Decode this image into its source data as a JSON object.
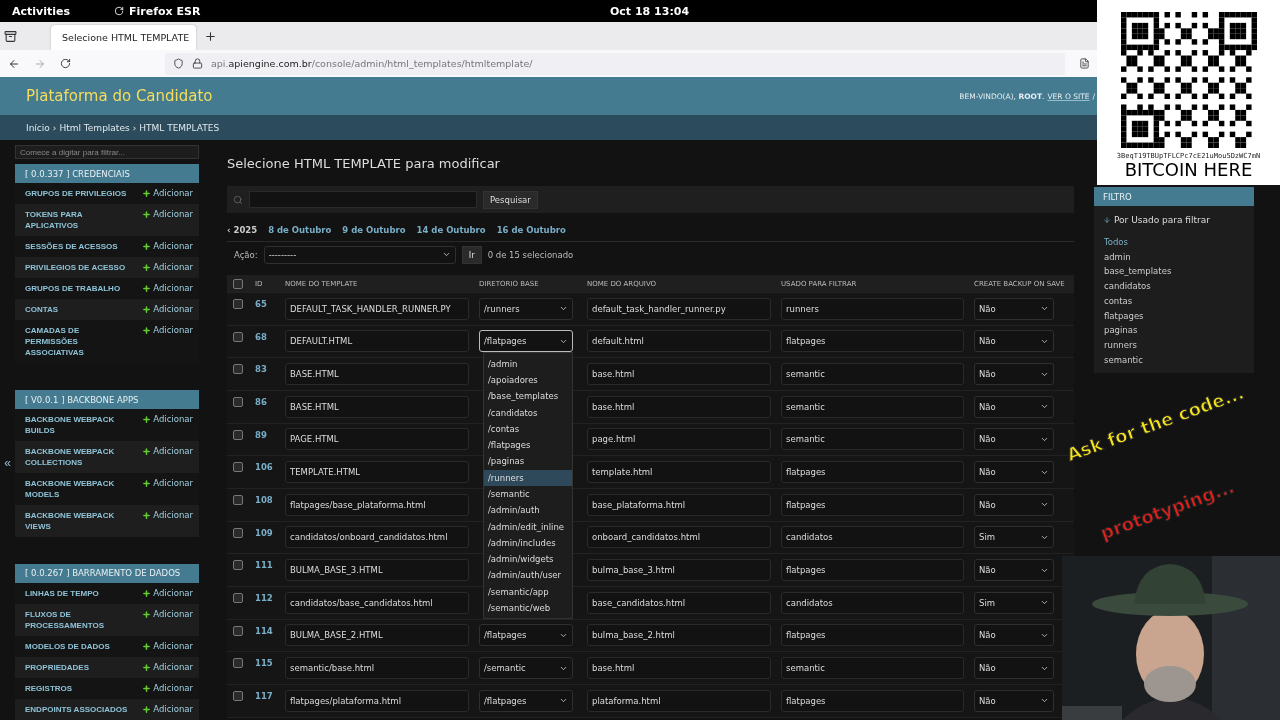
{
  "system_bar": {
    "activities": "Activities",
    "app": "Firefox ESR",
    "clock": "Oct 18  13:04"
  },
  "browser": {
    "tab": {
      "title": "Selecione HTML TEMPLATE",
      "selected": true
    },
    "url": {
      "host_prefix": "api.",
      "host": "apiengine.com.br",
      "path": "/console/admin/html_templates/htmltemplate/"
    }
  },
  "header": {
    "brand": "Plataforma do Candidato",
    "welcome": "BEM-VINDO(A), **ROOT**.",
    "view_site": "VER O SITE",
    "separator": "/"
  },
  "breadcrumbs": [
    "Início",
    "›",
    "Html Templates",
    "›",
    "HTML TEMPLATES"
  ],
  "sidebar": {
    "filter_placeholder": "Comece a digitar para filtrar...",
    "collapse": "«",
    "sections": [
      {
        "title": "[ 0.0.337 ] CREDENCIAIS",
        "items": [
          {
            "label": "GRUPOS DE PRIVILEGIOS",
            "action": "Adicionar"
          },
          {
            "label": "TOKENS PARA APLICATIVOS",
            "action": "Adicionar"
          },
          {
            "label": "SESSÕES DE ACESSOS",
            "action": "Adicionar"
          },
          {
            "label": "PRIVILEGIOS DE ACESSO",
            "action": "Adicionar"
          },
          {
            "label": "GRUPOS DE TRABALHO",
            "action": "Adicionar"
          },
          {
            "label": "CONTAS",
            "action": "Adicionar"
          },
          {
            "label": "CAMADAS DE PERMISSÕES ASSOCIATIVAS",
            "action": "Adicionar"
          }
        ]
      },
      {
        "title": "[ V0.0.1 ] BACKBONE APPS",
        "items": [
          {
            "label": "BACKBONE WEBPACK BUILDS",
            "action": "Adicionar"
          },
          {
            "label": "BACKBONE WEBPACK COLLECTIONS",
            "action": "Adicionar"
          },
          {
            "label": "BACKBONE WEBPACK MODELS",
            "action": "Adicionar"
          },
          {
            "label": "BACKBONE WEBPACK VIEWS",
            "action": "Adicionar"
          }
        ]
      },
      {
        "title": "[ 0.0.267 ] BARRAMENTO DE DADOS",
        "items": [
          {
            "label": "LINHAS DE TEMPO",
            "action": "Adicionar"
          },
          {
            "label": "FLUXOS DE PROCESSAMENTOS",
            "action": "Adicionar"
          },
          {
            "label": "MODELOS DE DADOS",
            "action": "Adicionar"
          },
          {
            "label": "PROPRIEDADES",
            "action": "Adicionar"
          },
          {
            "label": "REGISTROS",
            "action": "Adicionar"
          },
          {
            "label": "ENDPOINTS ASSOCIADOS",
            "action": "Adicionar"
          }
        ]
      }
    ]
  },
  "main": {
    "title": "Selecione HTML TEMPLATE para modificar",
    "search_button": "Pesquisar",
    "dates": [
      {
        "label": "‹ 2025",
        "kind": "back"
      },
      {
        "label": "8 de Outubro",
        "kind": "link"
      },
      {
        "label": "9 de Outubro",
        "kind": "link"
      },
      {
        "label": "14 de Outubro",
        "kind": "link"
      },
      {
        "label": "16 de Outubro",
        "kind": "link"
      }
    ],
    "action": {
      "label": "Ação:",
      "value": "---------",
      "go": "Ir",
      "counter": "0 de 15 selecionado"
    },
    "select_all": {
      "checked": false
    },
    "columns": [
      "ID",
      "NOME DO TEMPLATE",
      "DIRETORIO BASE",
      "NOME DO ARQUIVO",
      "USADO PARA FILTRAR",
      "CREATE BACKUP ON SAVE"
    ],
    "rows": [
      {
        "id": "65",
        "name": "DEFAULT_TASK_HANDLER_RUNNER.PY",
        "dir": "/runners",
        "file": "default_task_handler_runner.py",
        "used": "runners",
        "backup": "Não",
        "checked": false
      },
      {
        "id": "68",
        "name": "DEFAULT.HTML",
        "dir": "/flatpages",
        "file": "default.html",
        "used": "flatpages",
        "backup": "Não",
        "checked": false,
        "dropdown_open": true
      },
      {
        "id": "83",
        "name": "BASE.HTML",
        "file": "base.html",
        "used": "semantic",
        "backup": "Não",
        "checked": false
      },
      {
        "id": "86",
        "name": "BASE.HTML",
        "file": "base.html",
        "used": "semantic",
        "backup": "Não",
        "checked": false
      },
      {
        "id": "89",
        "name": "PAGE.HTML",
        "file": "page.html",
        "used": "semantic",
        "backup": "Não",
        "checked": false
      },
      {
        "id": "106",
        "name": "TEMPLATE.HTML",
        "file": "template.html",
        "used": "flatpages",
        "backup": "Não",
        "checked": false
      },
      {
        "id": "108",
        "name": "flatpages/base_plataforma.html",
        "file": "base_plataforma.html",
        "used": "flatpages",
        "backup": "Não",
        "checked": false
      },
      {
        "id": "109",
        "name": "candidatos/onboard_candidatos.html",
        "file": "onboard_candidatos.html",
        "used": "candidatos",
        "backup": "Sim",
        "checked": false
      },
      {
        "id": "111",
        "name": "BULMA_BASE_3.HTML",
        "file": "bulma_base_3.html",
        "used": "flatpages",
        "backup": "Não",
        "checked": false
      },
      {
        "id": "112",
        "name": "candidatos/base_candidatos.html",
        "file": "base_candidatos.html",
        "used": "candidatos",
        "backup": "Sim",
        "checked": false
      },
      {
        "id": "114",
        "name": "BULMA_BASE_2.HTML",
        "dir": "/flatpages",
        "file": "bulma_base_2.html",
        "used": "flatpages",
        "backup": "Não",
        "checked": false
      },
      {
        "id": "115",
        "name": "semantic/base.html",
        "dir": "/semantic",
        "file": "base.html",
        "used": "semantic",
        "backup": "Não",
        "checked": false
      },
      {
        "id": "117",
        "name": "flatpages/plataforma.html",
        "dir": "/flatpages",
        "file": "plataforma.html",
        "used": "flatpages",
        "backup": "Não",
        "checked": false
      }
    ],
    "dropdown_options": [
      {
        "label": "/admin",
        "selected": false
      },
      {
        "label": "/apoiadores",
        "selected": false
      },
      {
        "label": "/base_templates",
        "selected": false
      },
      {
        "label": "/candidatos",
        "selected": false
      },
      {
        "label": "/contas",
        "selected": false
      },
      {
        "label": "/flatpages",
        "selected": false
      },
      {
        "label": "/paginas",
        "selected": false
      },
      {
        "label": "/runners",
        "selected": true
      },
      {
        "label": "/semantic",
        "selected": false
      },
      {
        "label": "/admin/auth",
        "selected": false
      },
      {
        "label": "/admin/edit_inline",
        "selected": false
      },
      {
        "label": "/admin/includes",
        "selected": false
      },
      {
        "label": "/admin/widgets",
        "selected": false
      },
      {
        "label": "/admin/auth/user",
        "selected": false
      },
      {
        "label": "/semantic/app",
        "selected": false
      },
      {
        "label": "/semantic/web",
        "selected": false
      }
    ]
  },
  "filter": {
    "title": "FILTRO",
    "heading": "Por Usado para filtrar",
    "options": [
      {
        "label": "Todos",
        "selected": true
      },
      {
        "label": "admin",
        "selected": false
      },
      {
        "label": "base_templates",
        "selected": false
      },
      {
        "label": "candidatos",
        "selected": false
      },
      {
        "label": "contas",
        "selected": false
      },
      {
        "label": "flatpages",
        "selected": false
      },
      {
        "label": "paginas",
        "selected": false
      },
      {
        "label": "runners",
        "selected": false
      },
      {
        "label": "semantic",
        "selected": false
      }
    ]
  },
  "overlay": {
    "wallet": "3BeqT19TBUpTFLCPc7cE21uMou5DzWC7mN",
    "donate": "BITCOIN HERE",
    "line_1": "Ask for the code...",
    "line_2": "prototyping..."
  }
}
